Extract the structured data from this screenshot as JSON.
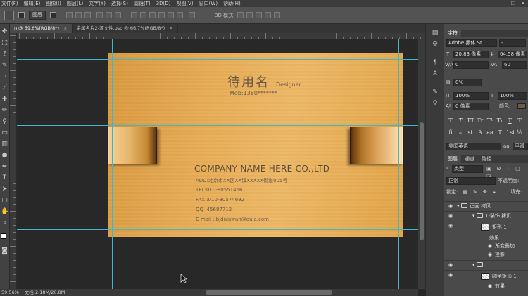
{
  "menubar": {
    "items": [
      "文件(F)",
      "编辑(E)",
      "图像(I)",
      "图层(L)",
      "文字(Y)",
      "选择(S)",
      "滤镜(T)",
      "3D(D)",
      "视图(V)",
      "窗口(W)",
      "帮助(H)"
    ]
  },
  "window_controls": {
    "minimize": "—",
    "restore": "❐",
    "close": "✕"
  },
  "options_bar": {
    "auto_select_target": "图层",
    "mode_3d_label": "3D 模式:"
  },
  "tabs": [
    {
      "label": "n @ 59.6%(RGB/8*)",
      "close": "×",
      "active": true
    },
    {
      "label": "金属名片2-源文件.psd @ 66.7%(RGB/8*)",
      "close": "×",
      "active": false
    }
  ],
  "card": {
    "name": "待用名",
    "role": "Designer",
    "mobile": "Mob:1380*******",
    "company": "COMPANY NAME HERE CO.,LTD",
    "lines": [
      "ADD:北京市XX区XX镇XXXXX街道005号",
      "TEL:010-80551456",
      "FAX :010-80574692",
      "QQ  :45687712",
      "E-mail :  bjduiawan@duia.com"
    ]
  },
  "status": {
    "zoom": "59.56%",
    "doc": "文档:2.18M/26.8M"
  },
  "character_panel": {
    "tab": "字符",
    "font_family": "Adobe 黑体 St...",
    "font_style": "-",
    "font_size": "20.83 像素",
    "leading": "64.58 像素",
    "kerning": "0",
    "tracking": "60",
    "baseline_scale": "0%",
    "vertical_scale": "100%",
    "horizontal_scale": "100%",
    "baseline_shift": "0 像素",
    "color_label": "颜色:",
    "color": "#6b5a4a",
    "type_buttons": [
      "T",
      "T",
      "TT",
      "Tr",
      "T¹",
      "T₁",
      "T",
      "Ŧ"
    ],
    "opentype_buttons": [
      "fi",
      "ℴ",
      "st",
      "A",
      "aa",
      "T",
      "1st",
      "½"
    ],
    "language": "美国英语",
    "antialias": "平滑"
  },
  "layers_panel": {
    "tabs": [
      "图层",
      "通道",
      "路径"
    ],
    "filter_kind": "类型",
    "blend_mode": "正常",
    "opacity_label": "不透明度:",
    "lock_label": "锁定:",
    "fill_label": "填充:",
    "layers": [
      {
        "name": "正面 拷贝",
        "kind": "group",
        "indent": 0
      },
      {
        "name": "1-装饰 拷贝",
        "kind": "group",
        "indent": 1
      },
      {
        "name": "矩形 1",
        "kind": "layer",
        "indent": 2
      },
      {
        "name": "效果",
        "kind": "effects",
        "indent": 3
      },
      {
        "name": "渐变叠加",
        "kind": "effect",
        "indent": 4
      },
      {
        "name": "投影",
        "kind": "effect",
        "indent": 4
      },
      {
        "name": "",
        "kind": "group",
        "indent": 1
      },
      {
        "name": "圆角矩形 1",
        "kind": "layer",
        "indent": 2
      },
      {
        "name": "效果",
        "kind": "effects",
        "indent": 3
      }
    ]
  },
  "colors": {
    "guide": "#3fb6c9",
    "panel_bg": "#4a4a4a",
    "app_bg": "#282828"
  }
}
